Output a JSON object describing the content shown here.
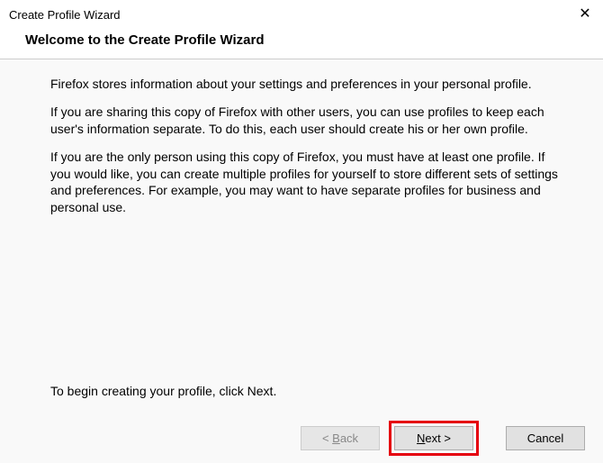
{
  "window": {
    "title": "Create Profile Wizard"
  },
  "header": {
    "title": "Welcome to the Create Profile Wizard"
  },
  "body": {
    "p1": "Firefox stores information about your settings and preferences in your personal profile.",
    "p2": "If you are sharing this copy of Firefox with other users, you can use profiles to keep each user's information separate. To do this, each user should create his or her own profile.",
    "p3": "If you are the only person using this copy of Firefox, you must have at least one profile. If you would like, you can create multiple profiles for yourself to store different sets of settings and preferences. For example, you may want to have separate profiles for business and personal use.",
    "begin": "To begin creating your profile, click Next."
  },
  "buttons": {
    "back_prefix": "< ",
    "back_mnemonic": "B",
    "back_suffix": "ack",
    "next_mnemonic": "N",
    "next_suffix": "ext >",
    "cancel": "Cancel"
  }
}
